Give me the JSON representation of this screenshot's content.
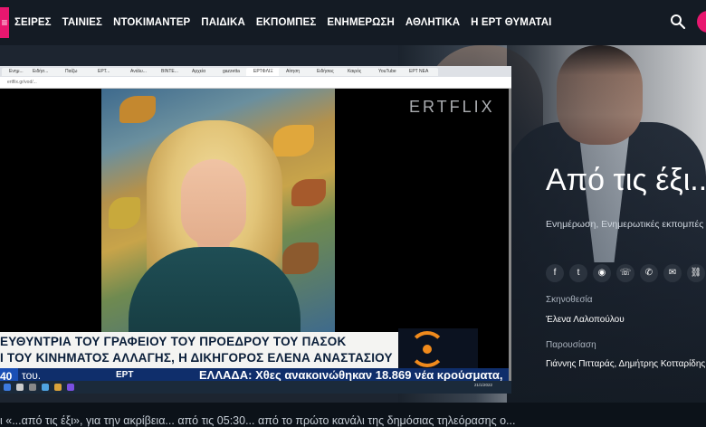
{
  "nav": {
    "menu_glyph": "≡",
    "items": [
      "ΣΕΙΡΕΣ",
      "ΤΑΙΝΙΕΣ",
      "ΝΤΟΚΙΜΑΝΤΕΡ",
      "ΠΑΙΔΙΚΑ",
      "ΕΚΠΟΜΠΕΣ",
      "ΕΝΗΜΕΡΩΣΗ",
      "ΑΘΛΗΤΙΚΑ",
      "Η ΕΡΤ ΘΥΜΑΤΑΙ"
    ],
    "accent": "#e8176f",
    "icons": [
      "menu-icon",
      "search-icon",
      "avatar"
    ]
  },
  "show": {
    "title": "Από τις έξι...",
    "genres": "Ενημέρωση, Ενημερωτικές εκπομπές",
    "share_icons": [
      "facebook-icon",
      "twitter-icon",
      "messenger-icon",
      "viber-icon",
      "whatsapp-icon",
      "email-icon",
      "link-icon"
    ],
    "direction_label": "Σκηνοθεσία",
    "direction_value": "Έλενα Λαλοπούλου",
    "presenters_label": "Παρουσίαση",
    "presenters_value": "Γιάννης Πιτταράς, Δημήτρης Κοτταρίδης"
  },
  "embedded": {
    "tabs": [
      "Ενημ...",
      "Ειδήσ...",
      "Παίζω",
      "ΕΡΤ...",
      "Ανάλυ...",
      "ΒΙΝΤΕ...",
      "Αρχεία",
      "gazzetta",
      "ΕΡΤΦΛΙΞ",
      "Αίτηση",
      "Ειδήσεις",
      "Καιρός",
      "YouTube",
      "ΕΡΤ ΝΕΑ"
    ],
    "url": "ertflix.gr/vod/...",
    "watermark": "ERTFLIX",
    "caption_line1": "ΕΥΘΥΝΤΡΙΑ ΤΟΥ ΓΡΑΦΕΙΟΥ ΤΟΥ ΠΡΟΕΔΡΟΥ ΤΟΥ ΠΑΣΟΚ",
    "caption_line2": "Ι ΤΟΥ ΚΙΝΗΜΑΤΟΣ ΑΛΛΑΓΗΣ, Η ΔΙΚΗΓΟΡΟΣ ΕΛΕΝΑ ΑΝΑΣΤΑΣΙΟΥ",
    "ticker_time": "40",
    "ticker_left": "του.",
    "ticker_channel": "ΕΡΤ",
    "ticker_news": "ΕΛΛΑΔΑ: Χθες ανακοινώθηκαν 18.869 νέα κρούσματα,",
    "clock": "21/1/2022"
  },
  "description": "ι «...από τις έξι», για την ακρίβεια... από τις 05:30... από το πρώτο κανάλι της δημόσιας τηλεόρασης ο..."
}
